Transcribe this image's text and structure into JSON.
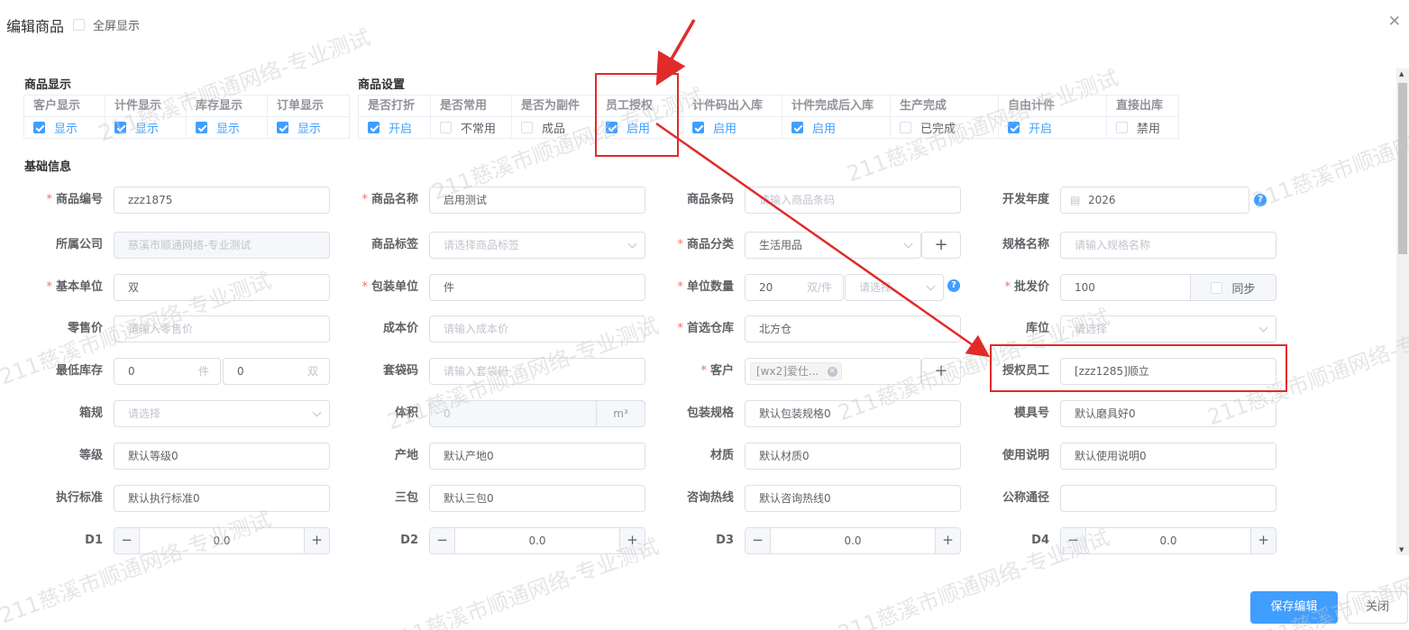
{
  "dialog": {
    "title": "编辑商品",
    "fullscreen_label": "全屏显示",
    "close_icon": "close-icon"
  },
  "display": {
    "section_title": "商品显示",
    "columns": [
      {
        "header": "客户显示",
        "value": "显示",
        "checked": true
      },
      {
        "header": "计件显示",
        "value": "显示",
        "checked": true
      },
      {
        "header": "库存显示",
        "value": "显示",
        "checked": true
      },
      {
        "header": "订单显示",
        "value": "显示",
        "checked": true
      }
    ]
  },
  "settings": {
    "section_title": "商品设置",
    "columns": [
      {
        "header": "是否打折",
        "value": "开启",
        "checked": true
      },
      {
        "header": "是否常用",
        "value": "不常用",
        "checked": false
      },
      {
        "header": "是否为副件",
        "value": "成品",
        "checked": false
      },
      {
        "header": "员工授权",
        "value": "启用",
        "checked": true
      },
      {
        "header": "计件码出入库",
        "value": "启用",
        "checked": true
      },
      {
        "header": "计件完成后入库",
        "value": "启用",
        "checked": true
      },
      {
        "header": "生产完成",
        "value": "已完成",
        "checked": false
      },
      {
        "header": "自由计件",
        "value": "开启",
        "checked": true
      },
      {
        "header": "直接出库",
        "value": "禁用",
        "checked": false
      }
    ]
  },
  "basic": {
    "section_title": "基础信息",
    "r1": {
      "code_label": "商品编号",
      "code_value": "zzz1875",
      "name_label": "商品名称",
      "name_value": "启用测试",
      "barcode_label": "商品条码",
      "barcode_placeholder": "请输入商品条码",
      "year_label": "开发年度",
      "year_value": "2026"
    },
    "r2": {
      "company_label": "所属公司",
      "company_value": "慈溪市顺通网络-专业测试",
      "tag_label": "商品标签",
      "tag_placeholder": "请选择商品标签",
      "category_label": "商品分类",
      "category_value": "生活用品",
      "spec_label": "规格名称",
      "spec_placeholder": "请输入规格名称"
    },
    "r3": {
      "unit_label": "基本单位",
      "unit_value": "双",
      "pack_unit_label": "包装单位",
      "pack_unit_value": "件",
      "unit_qty_label": "单位数量",
      "unit_qty_value": "20",
      "unit_qty_suffix": "双/件",
      "unit_qty_select_placeholder": "请选择",
      "wholesale_label": "批发价",
      "wholesale_value": "100",
      "sync_label": "同步"
    },
    "r4": {
      "retail_label": "零售价",
      "retail_placeholder": "请输入零售价",
      "cost_label": "成本价",
      "cost_placeholder": "请输入成本价",
      "warehouse_label": "首选仓库",
      "warehouse_value": "北方仓",
      "location_label": "库位",
      "location_placeholder": "请选择"
    },
    "r5": {
      "min_stock_label": "最低库存",
      "min_stock_value1": "0",
      "min_stock_suffix1": "件",
      "min_stock_value2": "0",
      "min_stock_suffix2": "双",
      "bag_label": "套袋码",
      "bag_placeholder": "请输入套袋码",
      "customer_label": "客户",
      "customer_tag": "[wx2]爱仕...",
      "auth_label": "授权员工",
      "auth_value": "[zzz1285]顺立"
    },
    "r6": {
      "box_label": "箱规",
      "box_placeholder": "请选择",
      "volume_label": "体积",
      "volume_value": "0",
      "volume_unit": "m³",
      "pack_spec_label": "包装规格",
      "pack_spec_value": "默认包装规格0",
      "mold_label": "模具号",
      "mold_value": "默认磨具好0"
    },
    "r7": {
      "grade_label": "等级",
      "grade_value": "默认等级0",
      "origin_label": "产地",
      "origin_value": "默认产地0",
      "material_label": "材质",
      "material_value": "默认材质0",
      "usage_label": "使用说明",
      "usage_value": "默认使用说明0"
    },
    "r8": {
      "standard_label": "执行标准",
      "standard_value": "默认执行标准0",
      "warranty_label": "三包",
      "warranty_value": "默认三包0",
      "hotline_label": "咨询热线",
      "hotline_value": "默认咨询热线0",
      "generic_label": "公称通径",
      "generic_value": ""
    },
    "r9": {
      "d1_label": "D1",
      "d1_value": "0.0",
      "d2_label": "D2",
      "d2_value": "0.0",
      "d3_label": "D3",
      "d3_value": "0.0",
      "d4_label": "D4",
      "d4_value": "0.0"
    }
  },
  "footer": {
    "save_label": "保存编辑",
    "close_label": "关闭"
  },
  "watermark_text": "211慈溪市顺通网络-专业测试",
  "colors": {
    "primary": "#409eff",
    "required": "#f56c6c",
    "annotation": "#e12b2b"
  }
}
